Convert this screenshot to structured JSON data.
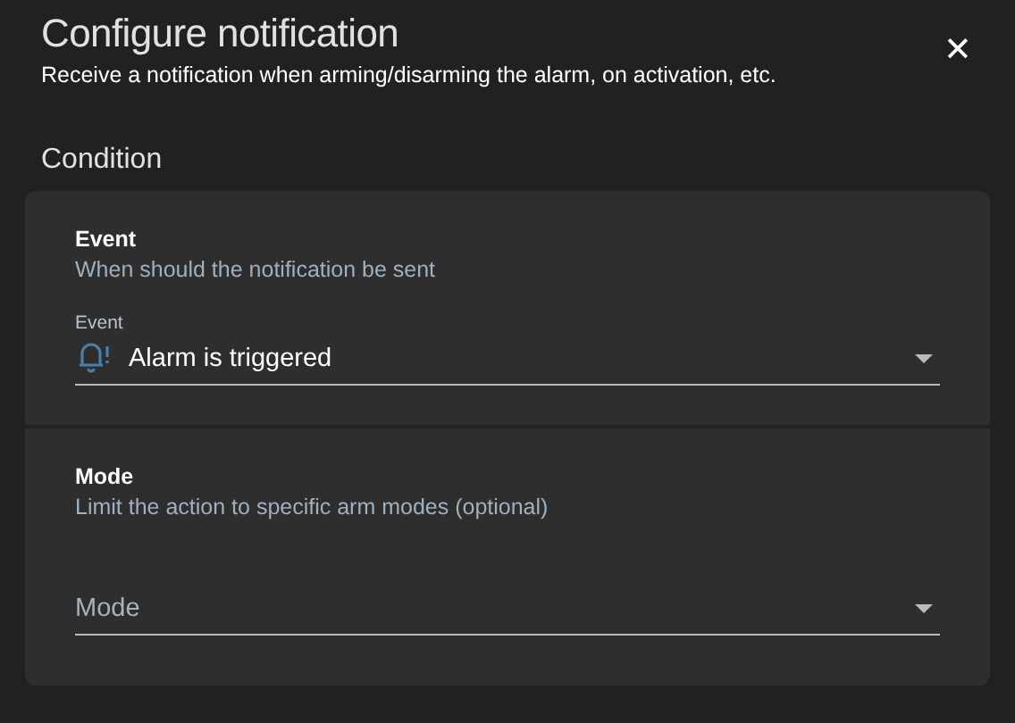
{
  "dialog": {
    "title": "Configure notification",
    "subtitle": "Receive a notification when arming/disarming the alarm, on activation, etc.",
    "close": "✕"
  },
  "section_title": "Condition",
  "settings": [
    {
      "title": "Event",
      "description": "When should the notification be sent",
      "field": {
        "label": "Event",
        "value": "Alarm is triggered"
      }
    },
    {
      "title": "Mode",
      "description": "Limit the action to specific arm modes (optional)",
      "field": {
        "placeholder": "Mode"
      }
    }
  ]
}
